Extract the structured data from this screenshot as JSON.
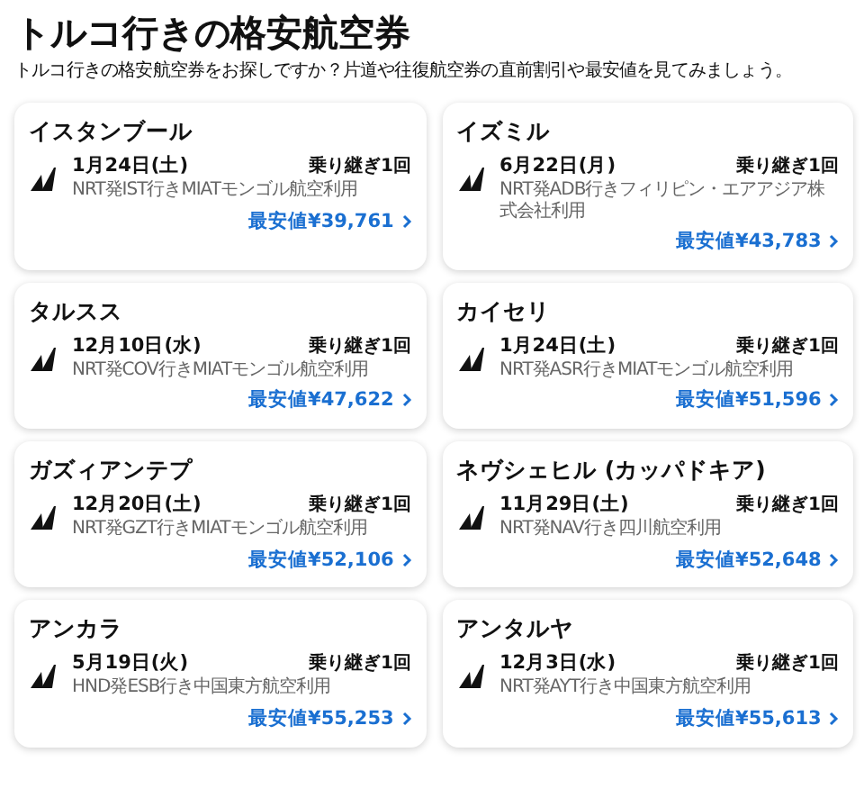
{
  "title": "トルコ行きの格安航空券",
  "subtitle": "トルコ行きの格安航空券をお探しですか？片道や往復航空券の直前割引や最安値を見てみましょう。",
  "cards": [
    {
      "city": "イスタンブール",
      "date": "1月24日(土)",
      "stops": "乗り継ぎ1回",
      "route": "NRT発IST行きMIATモンゴル航空利用",
      "price": "最安値¥39,761"
    },
    {
      "city": "イズミル",
      "date": "6月22日(月)",
      "stops": "乗り継ぎ1回",
      "route": "NRT発ADB行きフィリピン・エアアジア株式会社利用",
      "price": "最安値¥43,783"
    },
    {
      "city": "タルスス",
      "date": "12月10日(水)",
      "stops": "乗り継ぎ1回",
      "route": "NRT発COV行きMIATモンゴル航空利用",
      "price": "最安値¥47,622"
    },
    {
      "city": "カイセリ",
      "date": "1月24日(土)",
      "stops": "乗り継ぎ1回",
      "route": "NRT発ASR行きMIATモンゴル航空利用",
      "price": "最安値¥51,596"
    },
    {
      "city": "ガズィアンテプ",
      "date": "12月20日(土)",
      "stops": "乗り継ぎ1回",
      "route": "NRT発GZT行きMIATモンゴル航空利用",
      "price": "最安値¥52,106"
    },
    {
      "city": "ネヴシェヒル (カッパドキア)",
      "date": "11月29日(土)",
      "stops": "乗り継ぎ1回",
      "route": "NRT発NAV行き四川航空利用",
      "price": "最安値¥52,648"
    },
    {
      "city": "アンカラ",
      "date": "5月19日(火)",
      "stops": "乗り継ぎ1回",
      "route": "HND発ESB行き中国東方航空利用",
      "price": "最安値¥55,253"
    },
    {
      "city": "アンタルヤ",
      "date": "12月3日(水)",
      "stops": "乗り継ぎ1回",
      "route": "NRT発AYT行き中国東方航空利用",
      "price": "最安値¥55,613"
    }
  ]
}
